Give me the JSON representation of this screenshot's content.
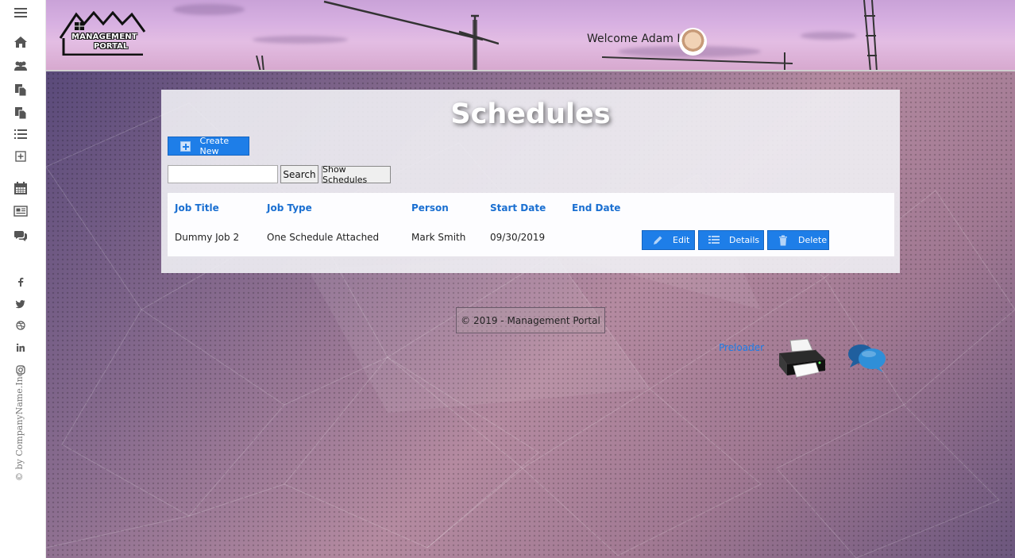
{
  "header": {
    "logo_line1": "MANAGEMENT",
    "logo_line2": "PORTAL",
    "welcome": "Welcome Adam I"
  },
  "sidebar": {
    "items": [
      {
        "icon": "menu-icon"
      },
      {
        "icon": "home-icon"
      },
      {
        "icon": "users-icon"
      },
      {
        "icon": "copy-icon"
      },
      {
        "icon": "copy-icon"
      },
      {
        "icon": "list-icon"
      },
      {
        "icon": "plus-square-icon"
      },
      {
        "icon": "calendar-icon"
      },
      {
        "icon": "newspaper-icon"
      },
      {
        "icon": "comments-icon"
      }
    ],
    "social": [
      "facebook-icon",
      "twitter-icon",
      "dribbble-icon",
      "linkedin-icon",
      "instagram-icon"
    ],
    "vertical_copyright": "© by CompanyName.Inc"
  },
  "page": {
    "title": "Schedules",
    "create_label": "Create New",
    "search_placeholder": "",
    "search_label": "Search",
    "show_label": "Show Schedules"
  },
  "table": {
    "headers": [
      "Job Title",
      "Job Type",
      "Person",
      "Start Date",
      "End Date"
    ],
    "rows": [
      {
        "job_title": "Dummy Job 2",
        "job_type": "One Schedule Attached",
        "person": "Mark Smith",
        "start_date": "09/30/2019",
        "end_date": "",
        "edit": "Edit",
        "details": "Details",
        "delete": "Delete"
      }
    ]
  },
  "footer": {
    "copyright": "© 2019 - Management Portal",
    "preloader": "Preloader"
  },
  "colors": {
    "accent": "#1e7ee8",
    "header_link": "#1a6fd1"
  }
}
